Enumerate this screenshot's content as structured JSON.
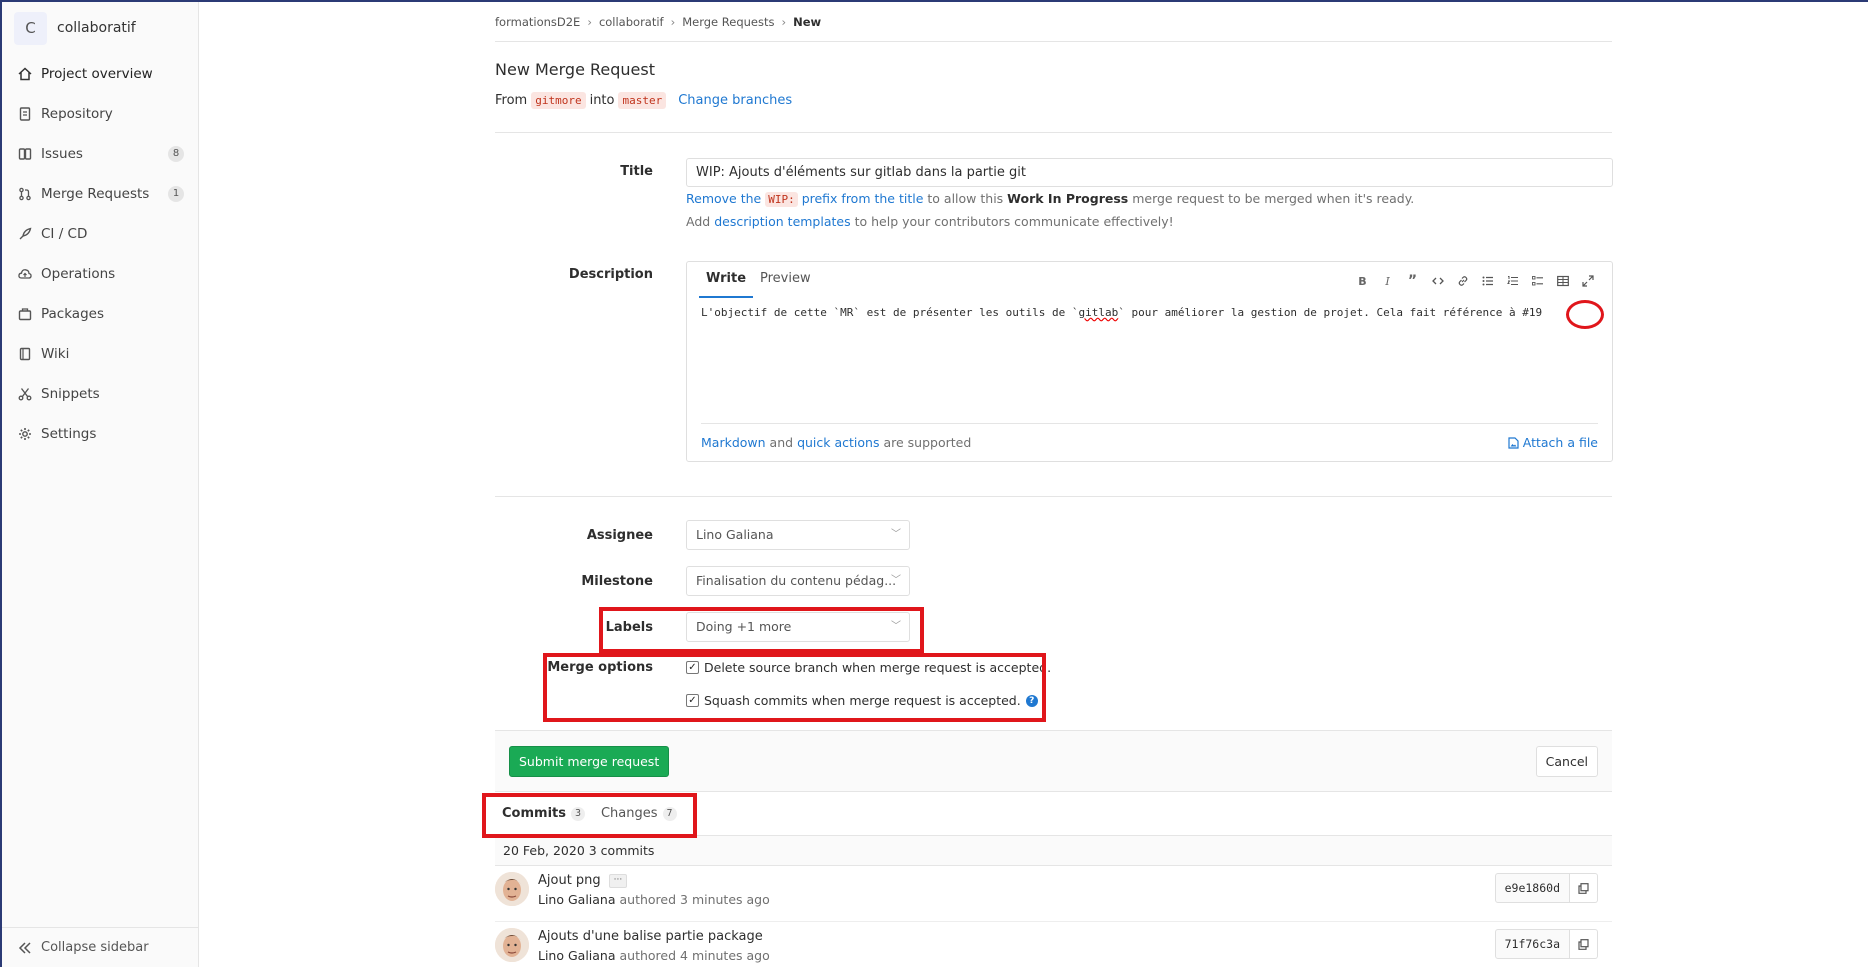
{
  "project": {
    "initial": "C",
    "name": "collaboratif"
  },
  "sidebar": {
    "items": [
      {
        "label": "Project overview",
        "icon": "home-icon"
      },
      {
        "label": "Repository",
        "icon": "doc-icon"
      },
      {
        "label": "Issues",
        "icon": "issues-icon",
        "badge": "8"
      },
      {
        "label": "Merge Requests",
        "icon": "merge-request-icon",
        "badge": "1"
      },
      {
        "label": "CI / CD",
        "icon": "rocket-icon"
      },
      {
        "label": "Operations",
        "icon": "cloud-icon"
      },
      {
        "label": "Packages",
        "icon": "package-icon"
      },
      {
        "label": "Wiki",
        "icon": "book-icon"
      },
      {
        "label": "Snippets",
        "icon": "scissors-icon"
      },
      {
        "label": "Settings",
        "icon": "gear-icon"
      }
    ],
    "collapse_label": "Collapse sidebar"
  },
  "breadcrumb": [
    "formationsD2E",
    "collaboratif",
    "Merge Requests",
    "New"
  ],
  "page_title": "New Merge Request",
  "branches": {
    "from_text": "From",
    "source": "gitmore",
    "into_text": "into",
    "target": "master",
    "change_link": "Change branches"
  },
  "form": {
    "title_label": "Title",
    "title_value": "WIP: Ajouts d'éléments sur gitlab dans la partie git",
    "help_wip": {
      "link1": "Remove the",
      "code": "WIP:",
      "link2": "prefix from the title",
      "text1": "to allow this",
      "bold": "Work In Progress",
      "text2": "merge request to be merged when it's ready."
    },
    "help_templates": {
      "text1": "Add",
      "link": "description templates",
      "text2": "to help your contributors communicate effectively!"
    },
    "description_label": "Description",
    "tabs": [
      "Write",
      "Preview"
    ],
    "description_text": {
      "p1": "L'objectif de cette `MR` est de présenter les outils de `",
      "misspelled": "gitlab",
      "p2": "` pour améliorer la gestion de projet. Cela fait référence à ",
      "ref": "#19"
    },
    "footer": {
      "link1": "Markdown",
      "and": "and",
      "link2": "quick actions",
      "supported": "are supported",
      "attach": "Attach a file"
    },
    "assignee_label": "Assignee",
    "assignee_value": "Lino Galiana",
    "milestone_label": "Milestone",
    "milestone_value": "Finalisation du contenu pédag...",
    "labels_label": "Labels",
    "labels_value": "Doing +1 more",
    "merge_options_label": "Merge options",
    "option_delete": "Delete source branch when merge request is accepted.",
    "option_squash": "Squash commits when merge request is accepted.",
    "submit": "Submit merge request",
    "cancel": "Cancel"
  },
  "commit_tabs": [
    {
      "label": "Commits",
      "count": "3"
    },
    {
      "label": "Changes",
      "count": "7"
    }
  ],
  "day_header": "20 Feb, 2020 3 commits",
  "commits": [
    {
      "title": "Ajout png",
      "author": "Lino Galiana",
      "meta": "authored 3 minutes ago",
      "sha": "e9e1860d",
      "more": "···"
    },
    {
      "title": "Ajouts d'une balise partie package",
      "author": "Lino Galiana",
      "meta": "authored 4 minutes ago",
      "sha": "71f76c3a"
    }
  ],
  "colors": {
    "accent": "#1f78d1",
    "success": "#1aaa55",
    "annotation": "#e0161b"
  }
}
